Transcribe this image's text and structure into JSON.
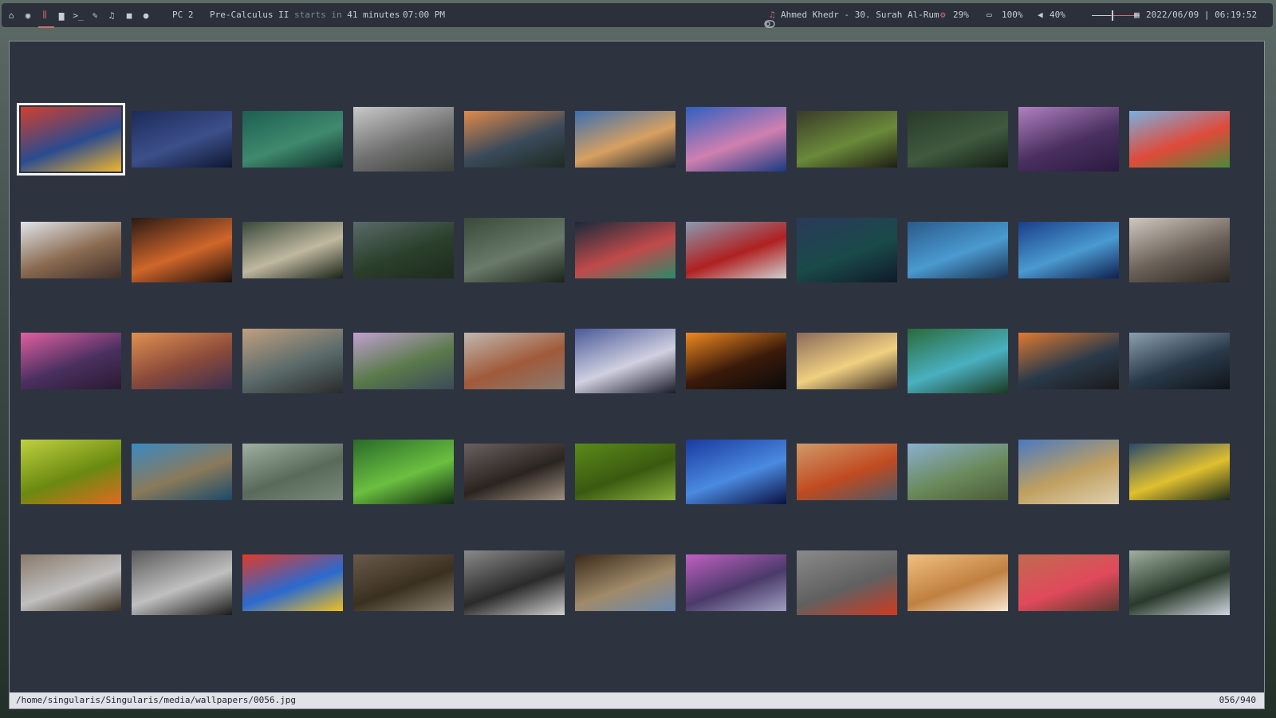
{
  "topbar": {
    "workspaces": [
      {
        "icon": "home-icon",
        "glyph": "⌂",
        "active": false
      },
      {
        "icon": "globe-icon",
        "glyph": "◉",
        "active": false
      },
      {
        "icon": "library-icon",
        "glyph": "⫼",
        "active": true
      },
      {
        "icon": "folder-icon",
        "glyph": "▆",
        "active": false
      },
      {
        "icon": "terminal-icon",
        "glyph": ">_",
        "active": false
      },
      {
        "icon": "edit-icon",
        "glyph": "✎",
        "active": false
      },
      {
        "icon": "music-icon",
        "glyph": "♫",
        "active": false
      },
      {
        "icon": "video-icon",
        "glyph": "■",
        "active": false
      },
      {
        "icon": "chat-icon",
        "glyph": "●",
        "active": false
      }
    ],
    "host": "PC 2",
    "event_name": "Pre-Calculus II",
    "event_mid": "starts in",
    "event_time_left": "41 minutes",
    "event_clock": "07:00 PM",
    "toggle_icon": "toggle-icon",
    "music_icon": "♫",
    "now_playing": "Ahmed Khedr - 30. Surah Al-Rum",
    "cpu_icon": "⚙",
    "cpu": "29%",
    "battery_icon": "▭",
    "battery": "100%",
    "volume_icon": "◀",
    "volume": "40%",
    "volume_level": 0.4,
    "calendar_icon": "▦",
    "datetime": "2022/06/09 | 06:19:52"
  },
  "viewer": {
    "selected_index": 0,
    "thumbnails": [
      [
        "#d23f2e",
        "#2a4b8f",
        "#f0b62d"
      ],
      [
        "#1d2b5a",
        "#3b4f8a",
        "#0f1730"
      ],
      [
        "#1e5e52",
        "#3f8a6e",
        "#0f2f2a"
      ],
      [
        "#c9c9c9",
        "#6f6f6f",
        "#3a3f3a"
      ],
      [
        "#e08a4a",
        "#3a4a5a",
        "#1e2a22"
      ],
      [
        "#3b6fb0",
        "#d8a060",
        "#1a2230"
      ],
      [
        "#2f5fc0",
        "#d080b0",
        "#1a3a80"
      ],
      [
        "#3a3a2a",
        "#6a8a3a",
        "#1e1e14"
      ],
      [
        "#2a3a2a",
        "#3f5a3f",
        "#151f15"
      ],
      [
        "#b080c0",
        "#4a3060",
        "#2a1a40"
      ],
      [
        "#7ab0e0",
        "#e04a3a",
        "#4a8a3a"
      ],
      [
        "#e0e4ea",
        "#8a6a50",
        "#40302a"
      ],
      [
        "#2a1a14",
        "#d0662a",
        "#1a0f0a"
      ],
      [
        "#3a4a3a",
        "#c0b8a0",
        "#1a2418"
      ],
      [
        "#5a6a6a",
        "#2a3f2a",
        "#1e2a1e"
      ],
      [
        "#3a4a3a",
        "#6a7a6a",
        "#1a241a"
      ],
      [
        "#1a2a3a",
        "#c04a4a",
        "#2a8a6a"
      ],
      [
        "#8a9ab0",
        "#b02020",
        "#d0d0d0"
      ],
      [
        "#2a3a5a",
        "#1a4a4a",
        "#0f1a2a"
      ],
      [
        "#2a5a8a",
        "#4a9ad0",
        "#1a3050"
      ],
      [
        "#1a3f8a",
        "#4a9ad0",
        "#0f2050"
      ],
      [
        "#d0c8c0",
        "#6a6058",
        "#2a2620"
      ],
      [
        "#e060a0",
        "#4a3060",
        "#2a1a30"
      ],
      [
        "#e09050",
        "#8a4a3a",
        "#3a3050"
      ],
      [
        "#c0a080",
        "#5a6a6a",
        "#2a2a2a"
      ],
      [
        "#c0a0d0",
        "#5a7a4a",
        "#3a4a5a"
      ],
      [
        "#c0b8b0",
        "#a05a3a",
        "#8a7a70"
      ],
      [
        "#4a5a9a",
        "#d0d0e0",
        "#1a1a2a"
      ],
      [
        "#f08a20",
        "#3a1a0a",
        "#0a0a0a"
      ],
      [
        "#8a6a5a",
        "#f0d080",
        "#3a2a24"
      ],
      [
        "#2a6a3a",
        "#4ab0c0",
        "#1a3a20"
      ],
      [
        "#e07a30",
        "#2a3a4a",
        "#1a1a1a"
      ],
      [
        "#8aa0b0",
        "#2a3a4a",
        "#0f1418"
      ],
      [
        "#c0d040",
        "#6a8a10",
        "#e06a20"
      ],
      [
        "#3a8ac0",
        "#8a7a5a",
        "#1a4a6a"
      ],
      [
        "#a0b0a0",
        "#5a6a5a",
        "#7a8a7a"
      ],
      [
        "#2a6a2a",
        "#6ac040",
        "#0f2a0f"
      ],
      [
        "#6a6060",
        "#2a2420",
        "#a09080"
      ],
      [
        "#5a8a1a",
        "#3a5a10",
        "#8ab040"
      ],
      [
        "#1a3aa0",
        "#4a8ae0",
        "#0a1040"
      ],
      [
        "#d09a6a",
        "#c04a20",
        "#4a5a6a"
      ],
      [
        "#8ab0d0",
        "#6a8a5a",
        "#4a5a3a"
      ],
      [
        "#4a7ac0",
        "#c0a060",
        "#e0d0b0"
      ],
      [
        "#2a4a6a",
        "#e0c030",
        "#1a2a1a"
      ],
      [
        "#8a7a6a",
        "#c0c0c0",
        "#3a3020"
      ],
      [
        "#5a5a5a",
        "#c0c0c0",
        "#1a1a1a"
      ],
      [
        "#e03a2a",
        "#2a6ad0",
        "#f0c020"
      ],
      [
        "#6a5a4a",
        "#3a3020",
        "#8a8070"
      ],
      [
        "#8a8a8a",
        "#2a2a2a",
        "#d0d0d0"
      ],
      [
        "#3a2a1a",
        "#a08a6a",
        "#6a8ab0"
      ],
      [
        "#c060c0",
        "#4a3a6a",
        "#a0a0c0"
      ],
      [
        "#8a8a8a",
        "#606060",
        "#d03a20"
      ],
      [
        "#f0c080",
        "#c08040",
        "#f8e8d0"
      ],
      [
        "#c06a50",
        "#e04a5a",
        "#5a3a30"
      ],
      [
        "#a0b0a0",
        "#2a3a2a",
        "#d0d8e0"
      ]
    ]
  },
  "statusbar": {
    "path": "/home/singularis/Singularis/media/wallpapers/0056.jpg",
    "count": "056/940"
  }
}
